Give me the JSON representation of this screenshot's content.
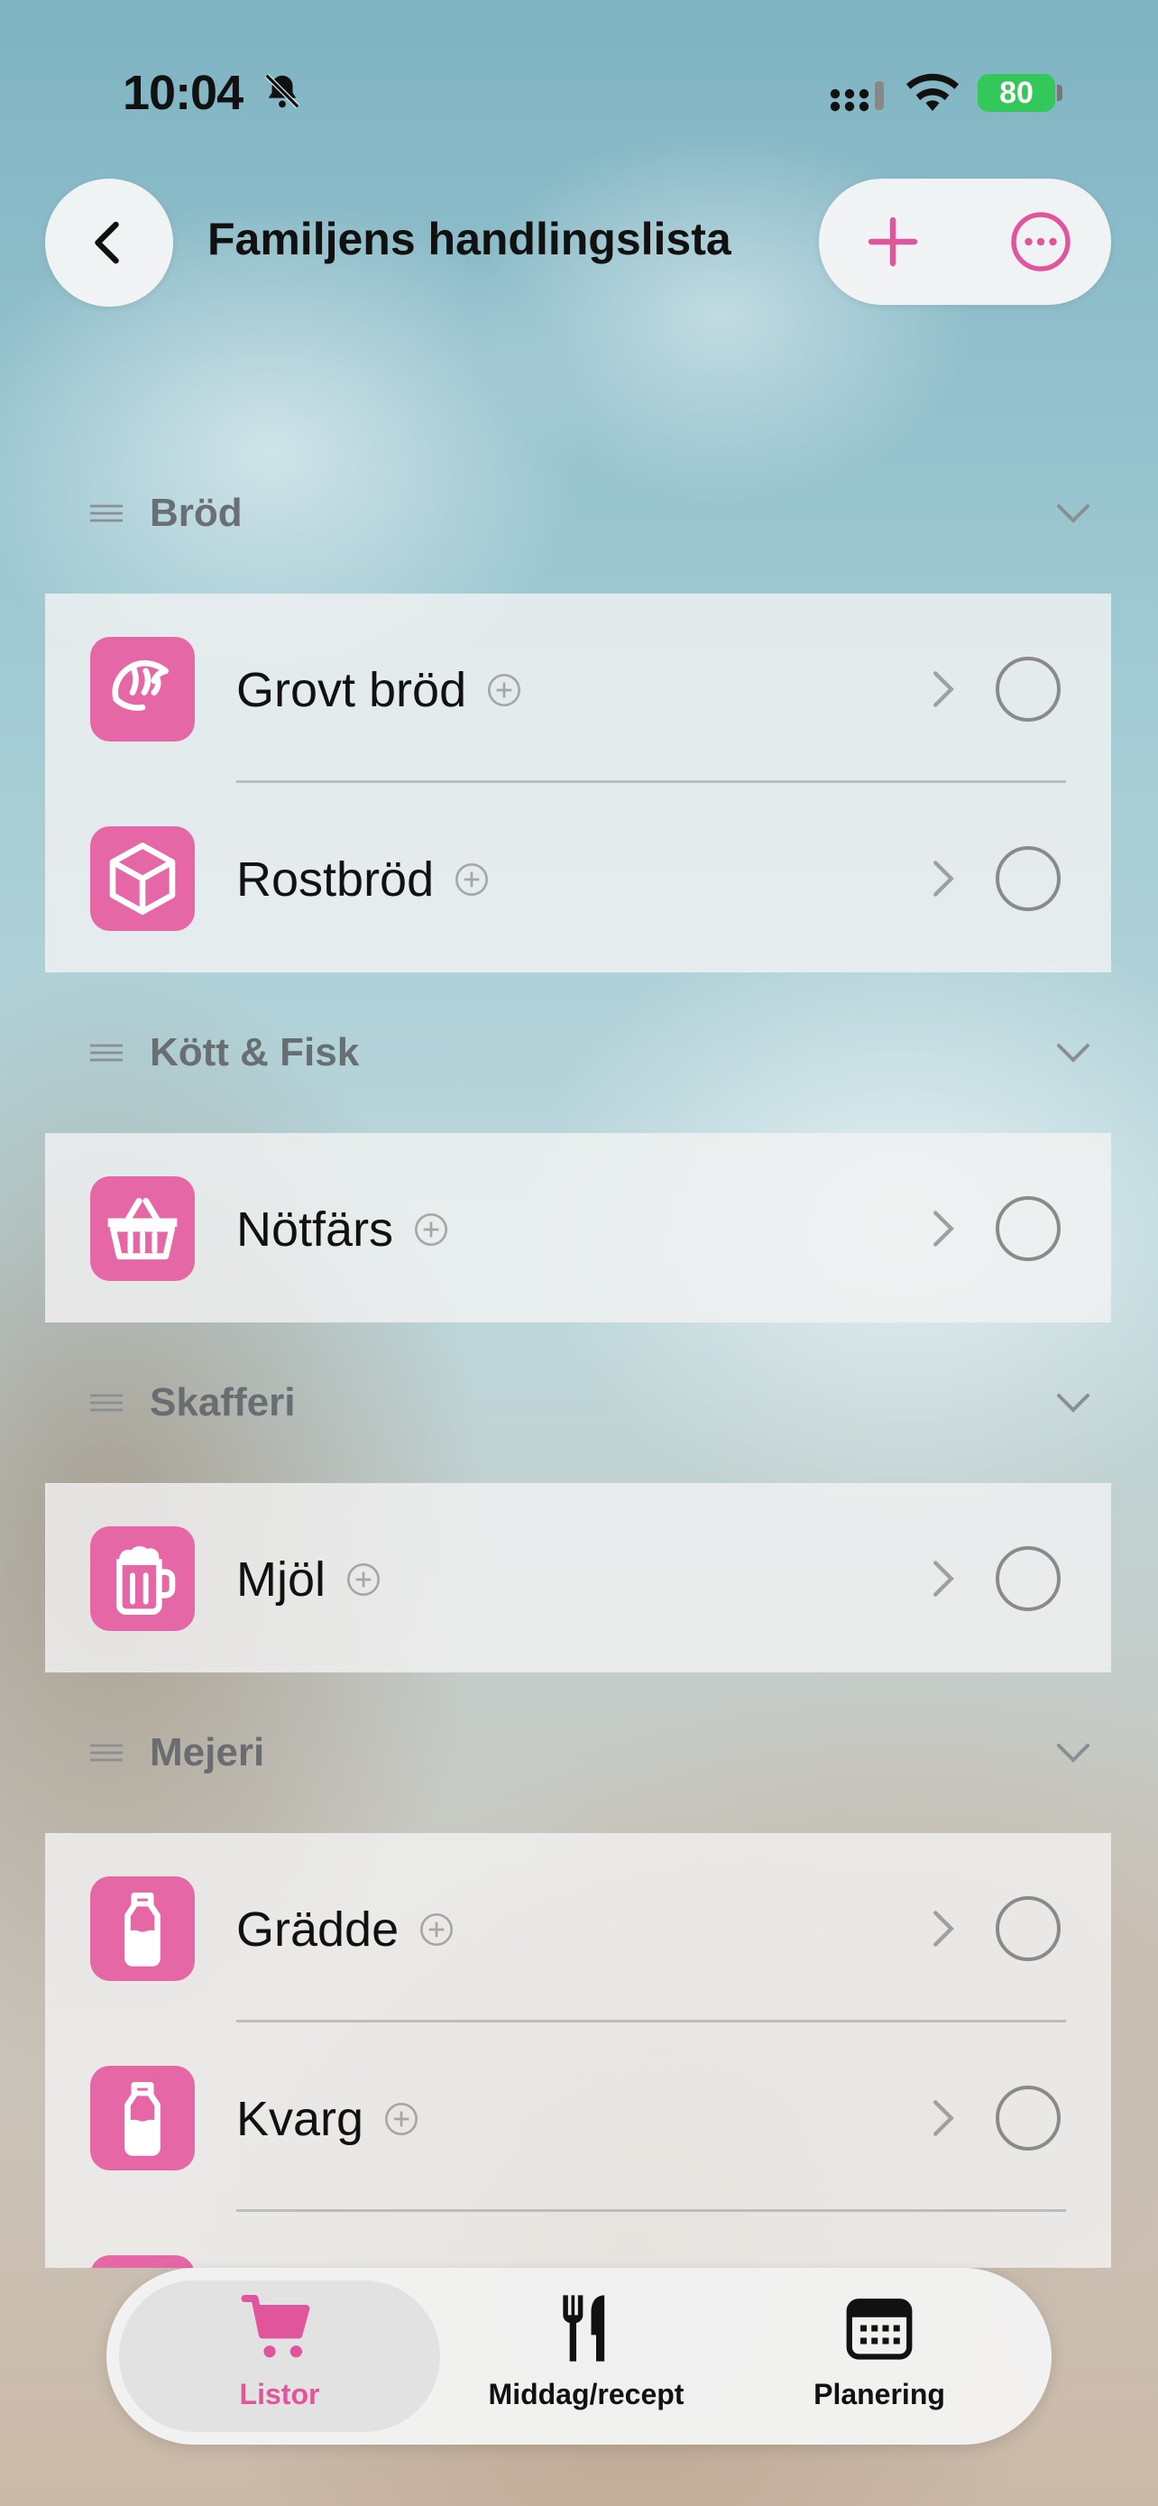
{
  "status_bar": {
    "time": "10:04",
    "battery": "80"
  },
  "header": {
    "title": "Familjens handlingslista"
  },
  "accent_color": "#e667a6",
  "sections": [
    {
      "name": "Bröd",
      "items": [
        {
          "label": "Grovt bröd",
          "icon": "croissant-icon"
        },
        {
          "label": "Rostbröd",
          "icon": "box-icon"
        }
      ]
    },
    {
      "name": "Kött & Fisk",
      "items": [
        {
          "label": "Nötfärs",
          "icon": "basket-icon"
        }
      ]
    },
    {
      "name": "Skafferi",
      "items": [
        {
          "label": "Mjöl",
          "icon": "mug-icon"
        }
      ]
    },
    {
      "name": "Mejeri",
      "items": [
        {
          "label": "Grädde",
          "icon": "milk-bottle-icon"
        },
        {
          "label": "Kvarg",
          "icon": "milk-bottle-icon"
        }
      ]
    }
  ],
  "tabs": [
    {
      "label": "Listor",
      "icon": "cart-icon",
      "active": true
    },
    {
      "label": "Middag/recept",
      "icon": "fork-knife-icon",
      "active": false
    },
    {
      "label": "Planering",
      "icon": "calendar-icon",
      "active": false
    }
  ]
}
